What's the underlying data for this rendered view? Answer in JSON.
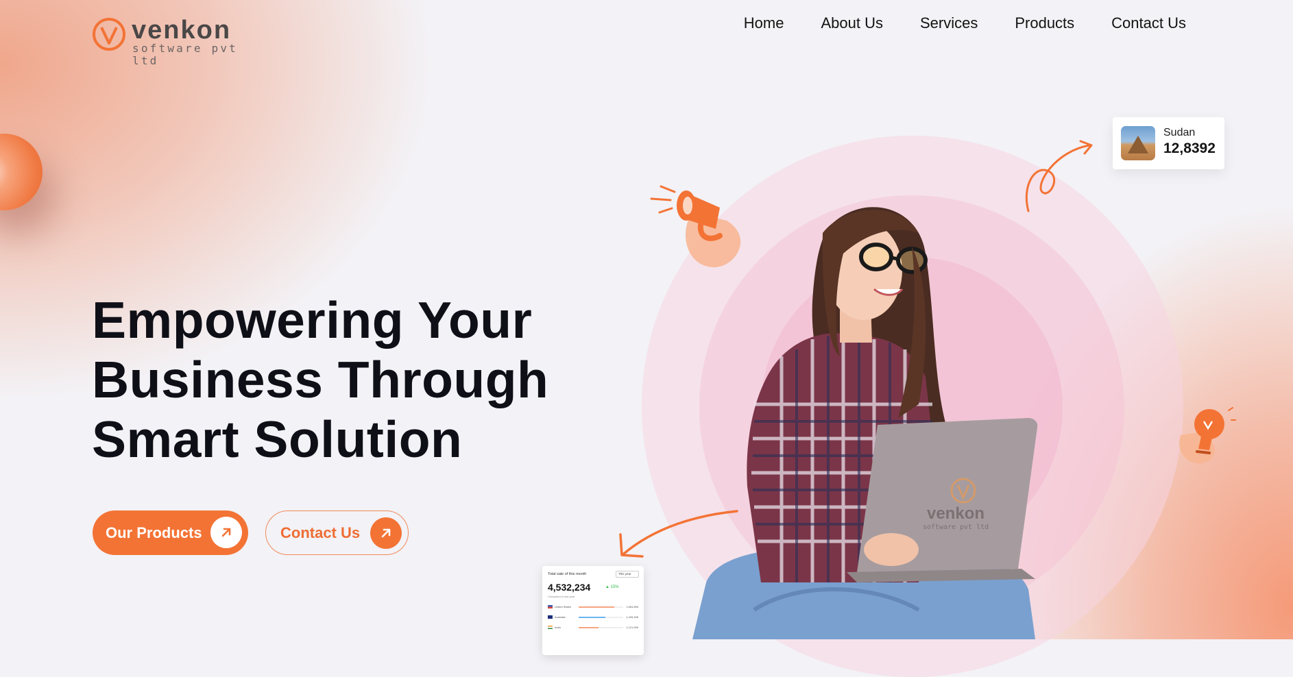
{
  "brand": {
    "name": "venkon",
    "tagline": "software pvt ltd",
    "accent_color": "#f37335"
  },
  "nav": {
    "items": [
      {
        "label": "Home"
      },
      {
        "label": "About Us"
      },
      {
        "label": "Services"
      },
      {
        "label": "Products"
      },
      {
        "label": "Contact Us"
      }
    ]
  },
  "hero": {
    "heading_line1": "Empowering Your",
    "heading_line2": "Business Through",
    "heading_line3": "Smart Solution",
    "primary_button": {
      "label": "Our Products",
      "icon": "arrow-up-right-icon"
    },
    "secondary_button": {
      "label": "Contact Us",
      "icon": "arrow-up-right-icon"
    }
  },
  "stat_card": {
    "country": "Sudan",
    "value": "12,8392",
    "thumbnail": "pyramid-photo"
  },
  "laptop_logo": {
    "name": "venkon",
    "tagline": "software pvt ltd"
  },
  "dashboard_card": {
    "title": "Total sale of this month",
    "filter": "This year",
    "total": "4,532,234",
    "change": "▲ 15%",
    "subtitle": "Compared to last year",
    "rows": [
      {
        "country": "United States",
        "value": "1,854,895",
        "progress": 0.8,
        "color": "#f5a57f"
      },
      {
        "country": "Australia",
        "value": "1,405,498",
        "progress": 0.6,
        "color": "#6cb5ee"
      },
      {
        "country": "India",
        "value": "1,121,059",
        "progress": 0.45,
        "color": "#f5a57f"
      }
    ]
  },
  "decor": {
    "megaphone_icon": "megaphone-icon",
    "lightbulb_icon": "lightbulb-icon"
  }
}
